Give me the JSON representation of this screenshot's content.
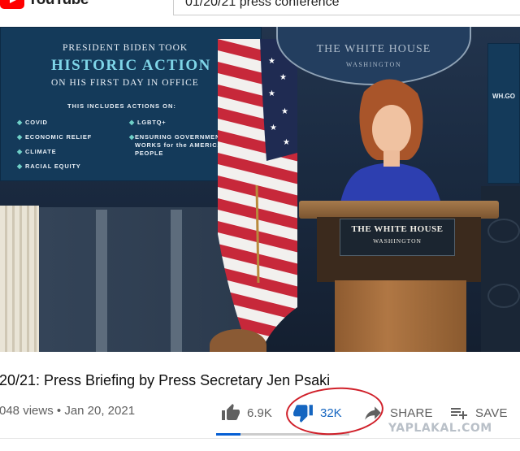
{
  "app": {
    "logo_text": "YouTube"
  },
  "search": {
    "query": "01/20/21 press conference"
  },
  "player": {
    "left_screen": {
      "line1": "PRESIDENT BIDEN TOOK",
      "line2": "HISTORIC ACTION",
      "line3": "ON HIS FIRST DAY IN OFFICE",
      "line4": "THIS INCLUDES ACTIONS ON:",
      "items_left": [
        "COVID",
        "ECONOMIC RELIEF",
        "CLIMATE",
        "RACIAL EQUITY"
      ],
      "items_right": [
        "LGBTQ+",
        "ENSURING GOVERNMENT WORKS for the AMERICAN PEOPLE"
      ]
    },
    "oval_sign": {
      "title": "THE WHITE HOUSE",
      "subtitle": "WASHINGTON"
    },
    "right_screen": {
      "text": "WH.GO"
    },
    "podium": {
      "title": "THE WHITE HOUSE",
      "subtitle": "WASHINGTON"
    }
  },
  "video": {
    "title": "20/21: Press Briefing by Press Secretary Jen Psaki",
    "views": "048 views",
    "separator": "•",
    "date": "Jan 20, 2021"
  },
  "actions": {
    "like_count": "6.9K",
    "dislike_count": "32K",
    "share_label": "SHARE",
    "save_label": "SAVE",
    "like_ratio": 0.18
  },
  "colors": {
    "accent": "#065fd4",
    "dislike_active": "#1565c0",
    "annotation": "#d0202a",
    "brand": "#ff0000"
  },
  "watermark": "YAPLAKAL.COM"
}
